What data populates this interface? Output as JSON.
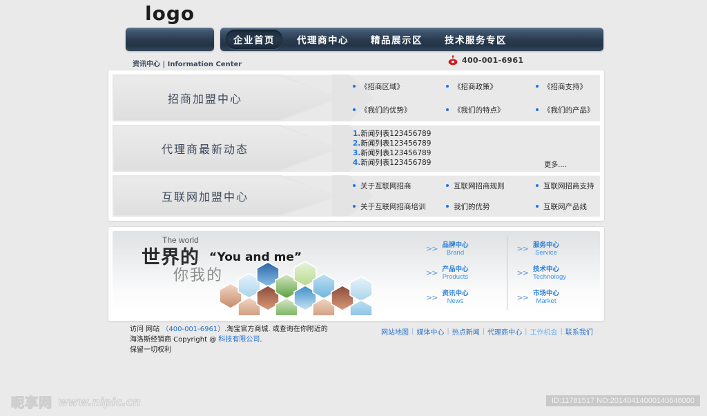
{
  "site": {
    "logo_text": "logo",
    "info_label": "资讯中心 | Information Center",
    "phone": "400-001-6961"
  },
  "nav": {
    "items": [
      {
        "label": "企业首页",
        "active": true
      },
      {
        "label": "代理商中心",
        "active": false
      },
      {
        "label": "精品展示区",
        "active": false
      },
      {
        "label": "技术服务专区",
        "active": false
      }
    ]
  },
  "panels": [
    {
      "title": "招商加盟中心",
      "links": [
        "《招商区域》",
        "《招商政策》",
        "《招商支持》",
        "《我们的优势》",
        "《我们的特点》",
        "《我们的产品》"
      ]
    },
    {
      "title": "代理商最新动态",
      "news": [
        {
          "num": "1.",
          "text": "新闻列表123456789"
        },
        {
          "num": "2.",
          "text": "新闻列表123456789"
        },
        {
          "num": "3.",
          "text": "新闻列表123456789"
        },
        {
          "num": "4.",
          "text": "新闻列表123456789"
        }
      ],
      "more_label": "更多...."
    },
    {
      "title": "互联网加盟中心",
      "links": [
        "关于互联网招商",
        "互联网招商规则",
        "互联网招商支持",
        "关于互联网招商培训",
        "我们的优势",
        "互联网产品线"
      ]
    }
  ],
  "banner": {
    "eyebrow": "The world",
    "headline_cn": "世界的",
    "headline_en": "“You and me”",
    "subline_cn": "你我的",
    "columns": {
      "left": [
        {
          "cn": "品牌中心",
          "en": "Brand"
        },
        {
          "cn": "产品中心",
          "en": "Products"
        },
        {
          "cn": "资讯中心",
          "en": "News"
        }
      ],
      "right": [
        {
          "cn": "服务中心",
          "en": "Service"
        },
        {
          "cn": "技术中心",
          "en": "Technology"
        },
        {
          "cn": "市场中心",
          "en": "Market"
        }
      ]
    },
    "chevron_glyph": ">>"
  },
  "footer": {
    "line1_a": "访问 网站",
    "line1_phone": "（400-001-6961）",
    "line1_b": ".淘宝官方商城. 或查询在你附近的",
    "line2_a": "海洛斯经销商  Copyright @ ",
    "line2_company": "科技有限公司",
    "line2_b": ".",
    "line3": " 保留一切权利",
    "links": [
      {
        "label": "网站地图",
        "lite": false
      },
      {
        "label": "媒体中心",
        "lite": false
      },
      {
        "label": "热点新闻",
        "lite": false
      },
      {
        "label": "代理商中心",
        "lite": false
      },
      {
        "label": "工作机会",
        "lite": true
      },
      {
        "label": "联系我们",
        "lite": false
      }
    ],
    "separator": "|"
  },
  "watermark": {
    "brand_cn": "昵享网",
    "url": "www.nipic.cn",
    "id_text": "ID:11781517 NO:20140414000140646000"
  },
  "colors": {
    "accent_blue": "#1a73e8",
    "nav_dark": "#2b3c50",
    "link_blue": "#2f74c8",
    "page_bg": "#eaeaea"
  }
}
